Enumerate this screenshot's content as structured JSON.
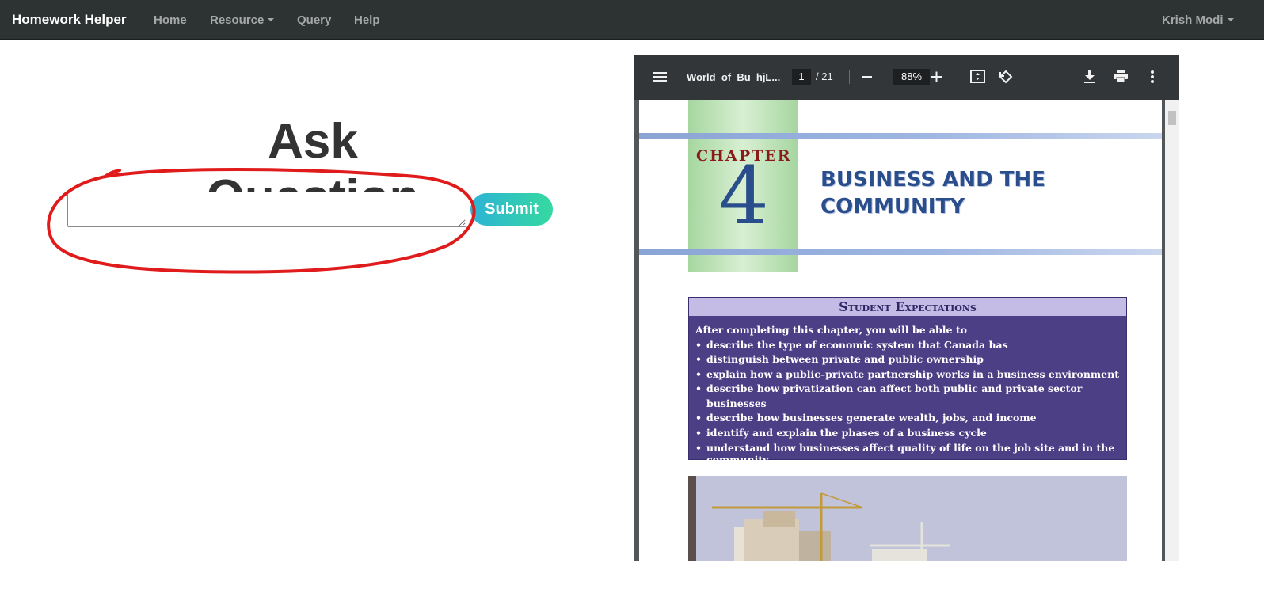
{
  "navbar": {
    "brand": "Homework Helper",
    "items": [
      {
        "label": "Home"
      },
      {
        "label": "Resource"
      },
      {
        "label": "Query"
      },
      {
        "label": "Help"
      }
    ],
    "user": "Krish Modi"
  },
  "main": {
    "title": "Ask Question",
    "question_value": "",
    "submit_label": "Submit",
    "annotation_color": "#e01b1b"
  },
  "pdf_viewer": {
    "filename": "World_of_Bu_hjL...",
    "current_page": "1",
    "total_pages": "/ 21",
    "zoom": "88%",
    "page": {
      "chapter_word": "CHAPTER",
      "chapter_number": "4",
      "chapter_title_line1": "BUSINESS AND THE",
      "chapter_title_line2": "COMMUNITY",
      "expectations_heading": "Student Expectations",
      "expectations_intro": "After completing this chapter, you will be able to",
      "expectations": [
        "describe the type of economic system that Canada has",
        "distinguish between private and public ownership",
        "explain how a public–private partnership works in a business environment",
        "describe how privatization can affect both public and private sector businesses",
        "describe how businesses generate wealth, jobs, and income",
        "identify and explain the phases of a business cycle",
        "understand how businesses affect quality of life on the job site and in the community"
      ]
    }
  }
}
